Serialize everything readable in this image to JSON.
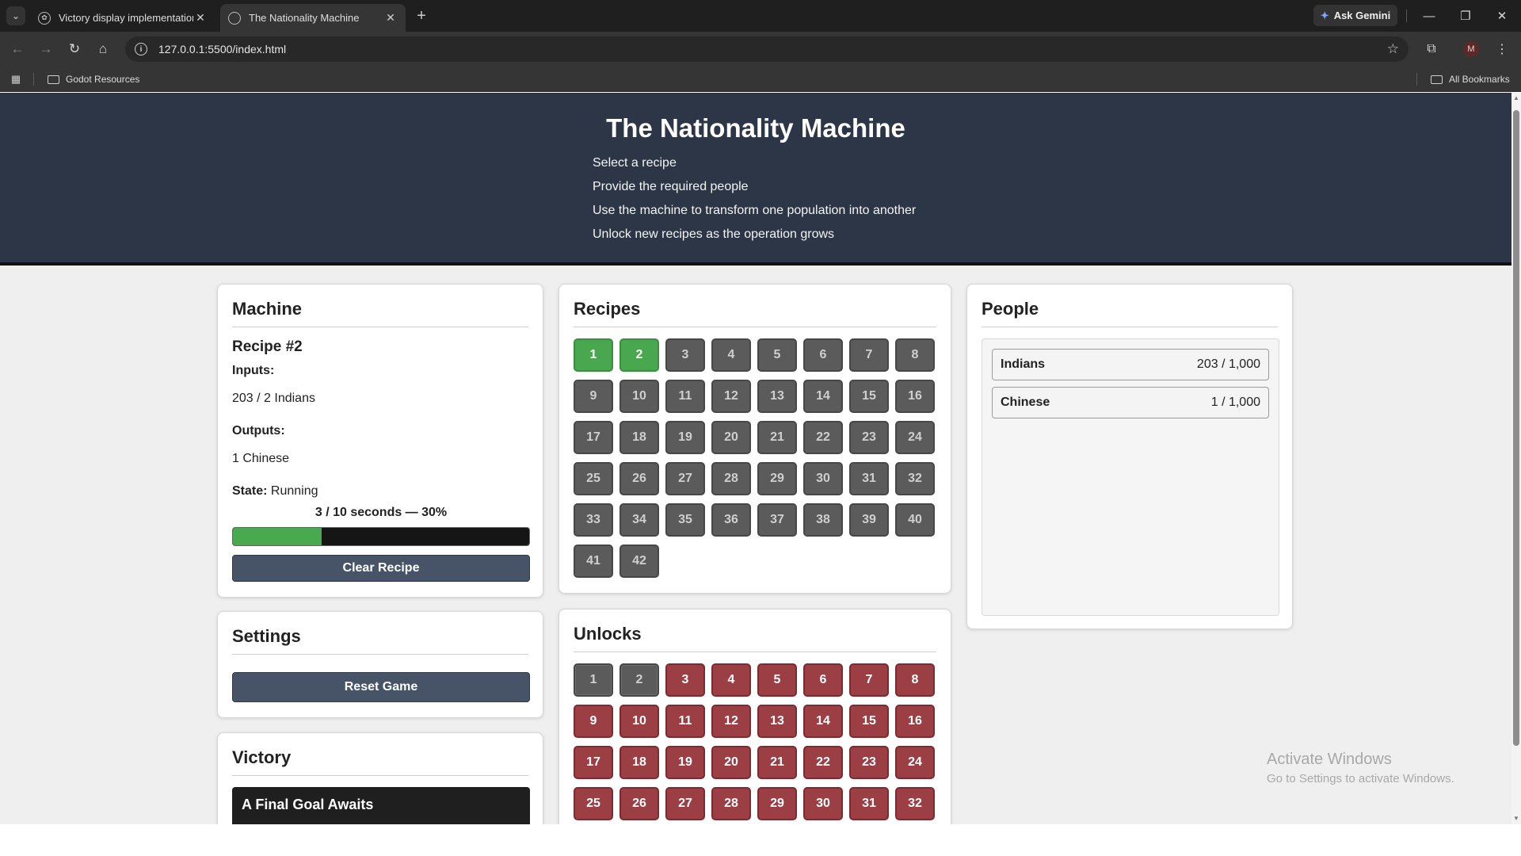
{
  "browser": {
    "tabs": [
      {
        "title": "Victory display implementation",
        "active": false
      },
      {
        "title": "The Nationality Machine",
        "active": true
      }
    ],
    "ask_gemini": "Ask Gemini",
    "url": "127.0.0.1:5500/index.html",
    "bookmarks": {
      "folder": "Godot Resources",
      "all": "All Bookmarks"
    },
    "profile_initial": "M"
  },
  "header": {
    "title": "The Nationality Machine",
    "steps": [
      "Select a recipe",
      "Provide the required people",
      "Use the machine to transform one population into another",
      "Unlock new recipes as the operation grows"
    ]
  },
  "machine": {
    "heading": "Machine",
    "recipe_title": "Recipe #2",
    "inputs_label": "Inputs:",
    "inputs_value": "203 / 2 Indians",
    "outputs_label": "Outputs:",
    "outputs_value": "1 Chinese",
    "state_label": "State:",
    "state_value": "Running",
    "progress_text": "3 / 10 seconds — 30%",
    "progress_fraction": 0.3,
    "clear_button": "Clear Recipe"
  },
  "settings": {
    "heading": "Settings",
    "reset_button": "Reset Game"
  },
  "victory": {
    "heading": "Victory",
    "card_title": "A Final Goal Awaits"
  },
  "recipes": {
    "heading": "Recipes",
    "count": 42,
    "unlocked": [
      1,
      2
    ]
  },
  "unlocks": {
    "heading": "Unlocks",
    "visible_count": 32,
    "purchased": [
      1,
      2
    ]
  },
  "people": {
    "heading": "People",
    "items": [
      {
        "name": "Indians",
        "value": "203 / 1,000"
      },
      {
        "name": "Chinese",
        "value": "1 / 1,000"
      }
    ]
  },
  "watermark": {
    "line1": "Activate Windows",
    "line2": "Go to Settings to activate Windows."
  },
  "colors": {
    "header_bg": "#2c3646",
    "recipe_unlocked": "#49a84f",
    "recipe_locked": "#5b5b5b",
    "unlock_available": "#9c3f44",
    "progress_fill": "#48a94e"
  }
}
